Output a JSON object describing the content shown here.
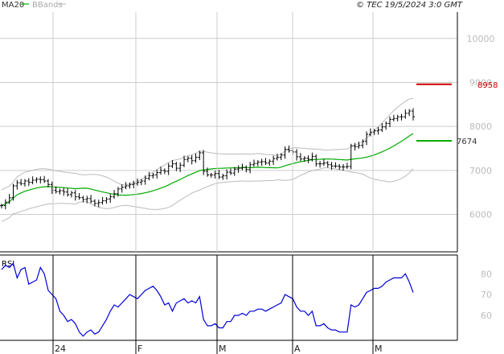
{
  "header": {
    "legend_ma": "MA20",
    "legend_bb": "BBands",
    "copyright": "© TEC 19/5/2024 3:0 GMT"
  },
  "colors": {
    "ma": "#00aa00",
    "bands": "#bbbbbb",
    "price": "#000000",
    "rsi": "#0000dd",
    "marker_upper": "#cc0000",
    "grid": "#cccccc"
  },
  "chart_data": [
    {
      "type": "line",
      "panel": "price",
      "y_tick_labels": [
        "10000",
        "9000",
        "8000",
        "7000",
        "6000"
      ],
      "y_ticks": [
        10000,
        9000,
        8000,
        7000,
        6000
      ],
      "ylim": [
        5150,
        10600
      ],
      "x_tick_labels": [
        "24",
        "F",
        "M",
        "A",
        "M"
      ],
      "x_ticks": [
        66,
        169,
        270,
        364,
        464
      ],
      "grid": true,
      "close": [
        6200,
        6280,
        6380,
        6650,
        6720,
        6700,
        6760,
        6730,
        6780,
        6800,
        6790,
        6760,
        6680,
        6550,
        6520,
        6540,
        6510,
        6450,
        6490,
        6400,
        6380,
        6340,
        6360,
        6300,
        6250,
        6270,
        6310,
        6350,
        6400,
        6470,
        6580,
        6620,
        6650,
        6680,
        6700,
        6730,
        6760,
        6820,
        6880,
        6900,
        6950,
        7000,
        6980,
        7100,
        7150,
        7050,
        7120,
        7250,
        7280,
        7220,
        7300,
        7400,
        6980,
        6900,
        6900,
        6930,
        6850,
        6880,
        6960,
        6940,
        7030,
        7050,
        7070,
        7020,
        7130,
        7160,
        7190,
        7200,
        7170,
        7210,
        7270,
        7300,
        7350,
        7480,
        7450,
        7420,
        7310,
        7260,
        7280,
        7250,
        7320,
        7150,
        7150,
        7170,
        7130,
        7100,
        7100,
        7080,
        7080,
        7090,
        7560,
        7540,
        7570,
        7660,
        7820,
        7870,
        7900,
        7920,
        7990,
        8070,
        8160,
        8180,
        8220,
        8220,
        8300,
        8350,
        8220
      ],
      "ma20_end_label": "7674",
      "upper_band_end_label": "8958",
      "upper_band_end_value": 8958,
      "ma20_end_value": 7674
    },
    {
      "type": "line",
      "panel": "rsi",
      "title": "RSI",
      "y_tick_labels": [
        "80",
        "70",
        "60"
      ],
      "y_ticks": [
        80,
        70,
        60
      ],
      "ylim": [
        48,
        89
      ],
      "values": [
        82,
        84,
        83,
        85,
        78,
        82,
        83,
        75,
        76,
        77,
        83,
        80,
        72,
        70,
        68,
        62,
        60,
        57,
        58,
        56,
        52,
        50,
        52,
        53,
        51,
        52,
        55,
        58,
        62,
        65,
        64,
        66,
        68,
        70,
        69,
        68,
        70,
        72,
        73,
        74,
        72,
        69,
        65,
        66,
        62,
        66,
        67,
        68,
        66,
        67,
        66,
        69,
        58,
        55,
        55,
        56,
        54,
        54,
        57,
        57,
        60,
        60,
        61,
        60,
        62,
        62,
        63,
        63,
        62,
        63,
        64,
        65,
        66,
        70,
        69,
        68,
        64,
        62,
        62,
        60,
        62,
        55,
        55,
        56,
        54,
        53,
        53,
        52,
        52,
        52,
        65,
        64,
        65,
        68,
        71,
        72,
        73,
        73,
        74,
        76,
        77,
        78,
        78,
        78,
        80,
        76,
        71
      ]
    }
  ]
}
